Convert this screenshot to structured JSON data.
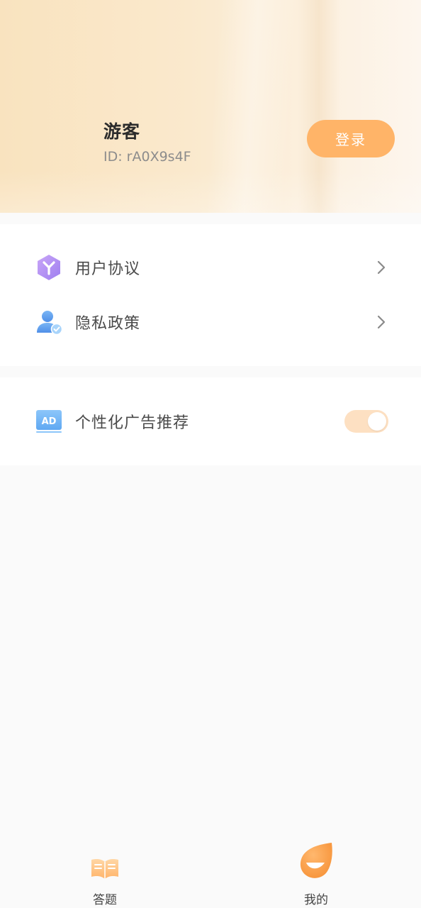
{
  "header": {
    "user_name": "游客",
    "user_id": "ID: rA0X9s4F",
    "login_label": "登录"
  },
  "menu": {
    "items": [
      {
        "label": "用户协议",
        "icon": "cube-y-icon"
      },
      {
        "label": "隐私政策",
        "icon": "user-check-icon"
      }
    ]
  },
  "settings": {
    "ad_label": "个性化广告推荐",
    "ad_icon": "ad-badge-icon",
    "ad_icon_text": "AD",
    "ad_toggle_on": true
  },
  "nav": {
    "items": [
      {
        "label": "答题",
        "icon": "open-book-icon"
      },
      {
        "label": "我的",
        "icon": "smile-drop-icon"
      }
    ]
  },
  "colors": {
    "accent": "#ffb468",
    "toggle_bg": "#fde0c2"
  }
}
